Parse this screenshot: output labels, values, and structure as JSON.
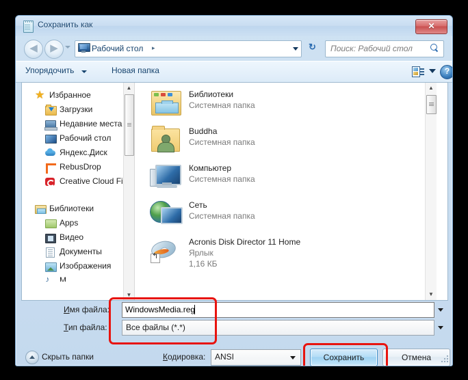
{
  "window": {
    "title": "Сохранить как",
    "icon": "notepad-document-icon",
    "close_label": "✕"
  },
  "nav": {
    "back_glyph": "◀",
    "forward_glyph": "▶",
    "recent_locations": "recent-locations-dropdown",
    "address": {
      "icon": "desktop-icon",
      "text": "Рабочий стол",
      "separator": "▸"
    },
    "refresh_glyph": "↻",
    "search": {
      "placeholder": "Поиск: Рабочий стол",
      "icon": "magnifier-icon"
    }
  },
  "toolbar": {
    "organize_label": "Упорядочить",
    "new_folder_label": "Новая папка",
    "view_icon": "view-layout-icon",
    "help_glyph": "?"
  },
  "sidebar": {
    "groups": [
      {
        "header": {
          "label": "Избранное",
          "icon": "star-icon"
        },
        "items": [
          {
            "label": "Загрузки",
            "icon": "downloads-folder-icon"
          },
          {
            "label": "Недавние места",
            "icon": "recent-places-icon"
          },
          {
            "label": "Рабочий стол",
            "icon": "desktop-icon"
          },
          {
            "label": "Яндекс.Диск",
            "icon": "yandex-disk-cloud-icon"
          },
          {
            "label": "RebusDrop",
            "icon": "rebusdrop-icon"
          },
          {
            "label": "Creative Cloud Fi",
            "icon": "creative-cloud-icon"
          }
        ]
      },
      {
        "header": {
          "label": "Библиотеки",
          "icon": "libraries-icon"
        },
        "items": [
          {
            "label": "Apps",
            "icon": "apps-library-icon"
          },
          {
            "label": "Видео",
            "icon": "video-library-icon"
          },
          {
            "label": "Документы",
            "icon": "documents-library-icon"
          },
          {
            "label": "Изображения",
            "icon": "pictures-library-icon"
          },
          {
            "label": "М",
            "icon": "music-library-icon"
          }
        ]
      }
    ],
    "scrollbar": {
      "up_glyph": "▲",
      "down_glyph": "▼"
    }
  },
  "filelist": {
    "items": [
      {
        "name": "Библиотеки",
        "type": "Системная папка",
        "size": "",
        "icon": "libraries-folder-icon"
      },
      {
        "name": "Buddha",
        "type": "Системная папка",
        "size": "",
        "icon": "user-folder-icon"
      },
      {
        "name": "Компьютер",
        "type": "Системная папка",
        "size": "",
        "icon": "computer-icon"
      },
      {
        "name": "Сеть",
        "type": "Системная папка",
        "size": "",
        "icon": "network-icon"
      },
      {
        "name": "Acronis Disk Director 11 Home",
        "type": "Ярлык",
        "size": "1,16 КБ",
        "icon": "disc-shortcut-icon"
      }
    ],
    "scrollbar": {
      "up_glyph": "▲",
      "down_glyph": "▼"
    }
  },
  "form": {
    "filename_label": "Имя файла:",
    "filename_label_accel": "И",
    "filename_label_rest": "мя файла:",
    "filename_value": "WindowsMedia.reg",
    "filetype_label_accel": "Т",
    "filetype_label_rest": "ип файла:",
    "filetype_value": "Все файлы  (*.*)"
  },
  "footer": {
    "hide_folders_label": "Скрыть папки",
    "encoding_label_accel": "К",
    "encoding_label_rest": "одировка:",
    "encoding_value": "ANSI",
    "save_label": "Сохранить",
    "cancel_label": "Отмена"
  },
  "annotations": {
    "fields_highlight": "red-rounded-box-around-filename-and-filetype",
    "save_highlight": "red-rounded-box-around-save-button",
    "color": "#e8140f"
  }
}
